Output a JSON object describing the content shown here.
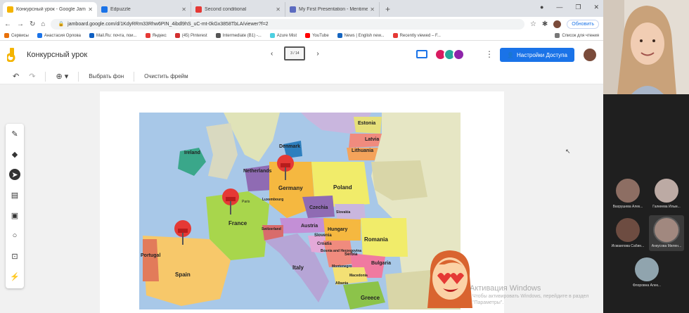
{
  "browser": {
    "tabs": [
      {
        "title": "Конкурсный урок - Google Jam",
        "color": "#f4b400",
        "active": true
      },
      {
        "title": "Edpuzzle",
        "color": "#1a73e8",
        "active": false
      },
      {
        "title": "Second conditional",
        "color": "#e53935",
        "active": false
      },
      {
        "title": "My First Presentation - Mentimeter",
        "color": "#5c6bc0",
        "active": false
      }
    ],
    "new_tab": "+",
    "window_controls": [
      "●",
      "—",
      "❐",
      "✕"
    ],
    "url": "jamboard.google.com/d/1KdyRRm33Rhw6PIN_4ibdl9hS_uC-mt-0kGx3858TbLA/viewer?f=2",
    "update_label": "Обновить",
    "bookmarks": [
      {
        "label": "Сервисы",
        "color": "#e8710a"
      },
      {
        "label": "Анастасия Орлова",
        "color": "#1a73e8"
      },
      {
        "label": "Mail.Ru: почта, пои...",
        "color": "#0f5fc2"
      },
      {
        "label": "Яндекс",
        "color": "#e53935"
      },
      {
        "label": "(45) Pinterest",
        "color": "#d32f2f"
      },
      {
        "label": "Intermediate (B1) -...",
        "color": "#555"
      },
      {
        "label": "Azure Mist",
        "color": "#4dd0e1"
      },
      {
        "label": "YouTube",
        "color": "#f00"
      },
      {
        "label": "News | English new...",
        "color": "#1565c0"
      },
      {
        "label": "Recently viewed – F...",
        "color": "#e53935"
      }
    ],
    "reading_list": "Список для чтения"
  },
  "jamboard": {
    "title": "Конкурсный урок",
    "frame_counter": "3 / 14",
    "prev": "‹",
    "next": "›",
    "share_label": "Настройки Доступа",
    "set_background": "Выбрать фон",
    "clear_frame": "Очистить фрейм",
    "avatar_colors": [
      "#d81b60",
      "#26a69a",
      "#8e24aa"
    ]
  },
  "map_labels": {
    "countries": [
      "Ireland",
      "Denmark",
      "Estonia",
      "Latvia",
      "Lithuania",
      "Netherlands",
      "Germany",
      "Poland",
      "Luxembourg",
      "Czechia",
      "Slovakia",
      "France",
      "Austria",
      "Hungary",
      "Switzerland",
      "Slovenia",
      "Croatia",
      "Romania",
      "Bosnia and Herzegovina",
      "Serbia",
      "Montenegro",
      "Macedonia",
      "Albania",
      "Bulgaria",
      "Italy",
      "Portugal",
      "Spain",
      "Greece",
      "Paris"
    ]
  },
  "watermark": {
    "title": "Активация Windows",
    "subtitle": "Чтобы активировать Windows, перейдите в раздел \"Параметры\"."
  },
  "participants": [
    {
      "name": "Вахрушева Алек...",
      "color": "#8d6e63"
    },
    {
      "name": "Галкеева Ильм...",
      "color": "#bcaaa4"
    },
    {
      "name": "Исмаилова Сабин...",
      "color": "#6d4c41"
    },
    {
      "name": "Анкусова Милен...",
      "color": "#a1887f"
    },
    {
      "name": "Флоровна Алек...",
      "color": "#90a4ae"
    }
  ]
}
